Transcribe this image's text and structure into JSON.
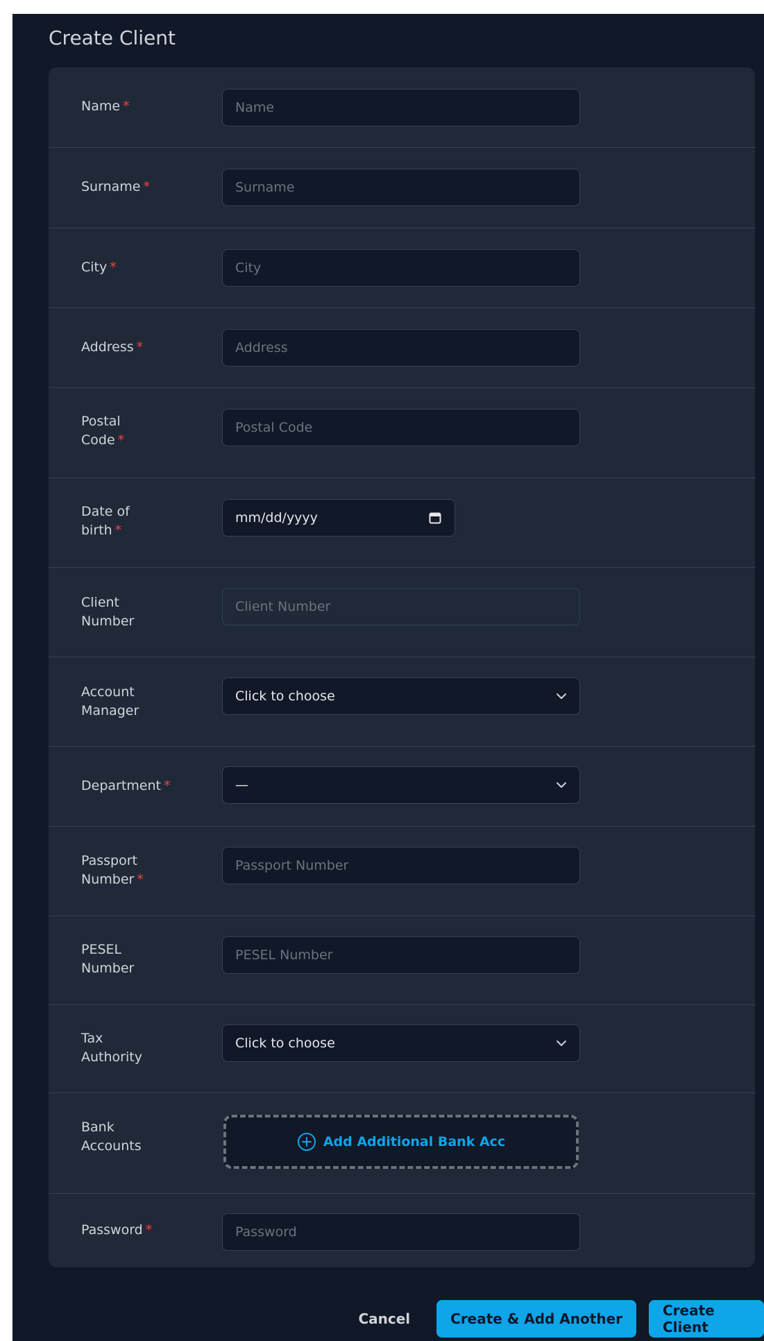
{
  "page": {
    "title": "Create Client"
  },
  "form": {
    "name": {
      "label": "Name",
      "required": "*",
      "placeholder": "Name",
      "value": ""
    },
    "surname": {
      "label": "Surname",
      "required": "*",
      "placeholder": "Surname",
      "value": ""
    },
    "city": {
      "label": "City",
      "required": "*",
      "placeholder": "City",
      "value": ""
    },
    "address": {
      "label": "Address",
      "required": "*",
      "placeholder": "Address",
      "value": ""
    },
    "postal_code": {
      "label_line1": "Postal",
      "label_line2": "Code",
      "required": "*",
      "placeholder": "Postal Code",
      "value": ""
    },
    "date_of_birth": {
      "label_line1": "Date of",
      "label_line2": "birth",
      "required": "*",
      "placeholder": "mm/dd/yyyy",
      "icon": "calendar-icon"
    },
    "client_number": {
      "label_line1": "Client",
      "label_line2": "Number",
      "placeholder": "Client Number",
      "value": ""
    },
    "account_manager": {
      "label_line1": "Account",
      "label_line2": "Manager",
      "selected": "Click to choose",
      "icon": "chevron-down-icon"
    },
    "department": {
      "label": "Department",
      "required": "*",
      "selected": "—",
      "icon": "chevron-down-icon"
    },
    "passport_number": {
      "label_line1": "Passport",
      "label_line2": "Number",
      "required": "*",
      "placeholder": "Passport Number",
      "value": ""
    },
    "pesel_number": {
      "label_line1": "PESEL",
      "label_line2": "Number",
      "placeholder": "PESEL Number",
      "value": ""
    },
    "tax_authority": {
      "label_line1": "Tax",
      "label_line2": "Authority",
      "selected": "Click to choose",
      "icon": "chevron-down-icon"
    },
    "bank_accounts": {
      "label_line1": "Bank",
      "label_line2": "Accounts",
      "add_label": "Add Additional Bank Acc",
      "icon": "plus-circle-icon"
    },
    "password": {
      "label": "Password",
      "required": "*",
      "placeholder": "Password",
      "value": ""
    }
  },
  "actions": {
    "cancel": "Cancel",
    "create_and_add_another": "Create & Add Another",
    "create": "Create Client"
  },
  "colors": {
    "background": "#111827",
    "card": "#1f2937",
    "accent": "#0ea5e9",
    "required": "#ef4444"
  }
}
